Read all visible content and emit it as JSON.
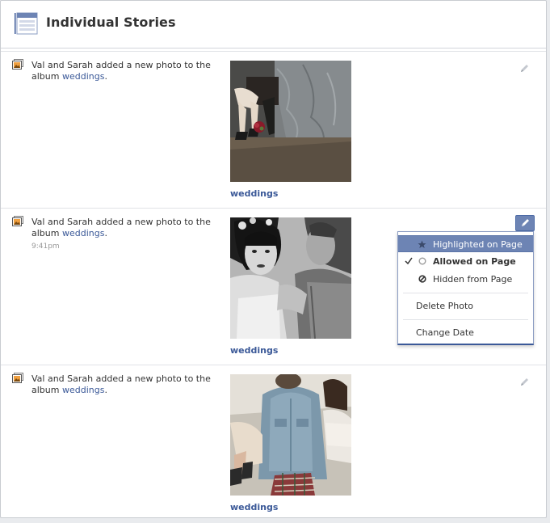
{
  "page": {
    "title": "Individual Stories"
  },
  "stories": [
    {
      "text": "Val and Sarah added a new photo to the album ",
      "album_link": "weddings",
      "period": ".",
      "time": "",
      "caption": "weddings"
    },
    {
      "text": "Val and Sarah added a new photo to the album ",
      "album_link": "weddings",
      "period": ".",
      "time": "9:41pm",
      "caption": "weddings"
    },
    {
      "text": "Val and Sarah added a new photo to the album ",
      "album_link": "weddings",
      "period": ".",
      "time": "",
      "caption": "weddings"
    }
  ],
  "menu": {
    "highlighted": "Highlighted on Page",
    "allowed": "Allowed on Page",
    "hidden": "Hidden from Page",
    "delete": "Delete Photo",
    "change_date": "Change Date"
  },
  "icons": {
    "header": "page-layout-icon",
    "story": "photo-story-icon",
    "edit": "pencil-icon",
    "star": "star-icon",
    "check": "checkmark-icon",
    "circle": "radio-circle-icon",
    "blocked": "blocked-icon"
  },
  "colors": {
    "link": "#3b5998",
    "highlight": "#6d84b4"
  }
}
